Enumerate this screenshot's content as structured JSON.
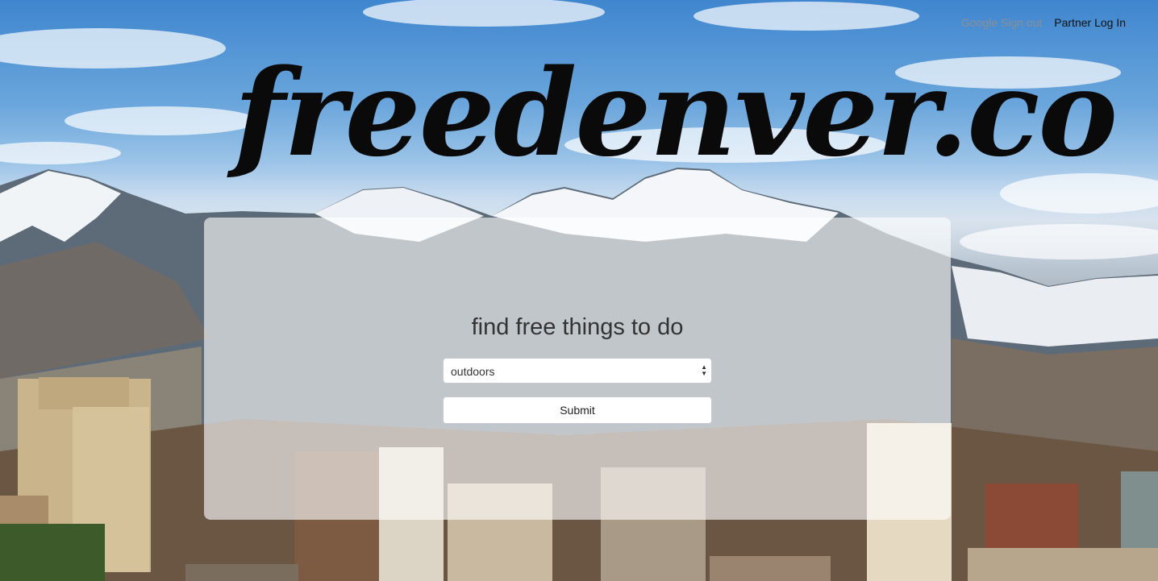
{
  "nav": {
    "google_sign_out": "Google Sign out",
    "partner_login": "Partner Log In"
  },
  "logo": {
    "text": "freedenver.co"
  },
  "search": {
    "heading": "find free things to do",
    "category_selected": "outdoors",
    "submit_label": "Submit"
  },
  "colors": {
    "logo": "#0a0a0a",
    "google_link": "#8a8f96",
    "partner_link": "#111111",
    "panel": "rgba(255,255,255,0.62)"
  }
}
